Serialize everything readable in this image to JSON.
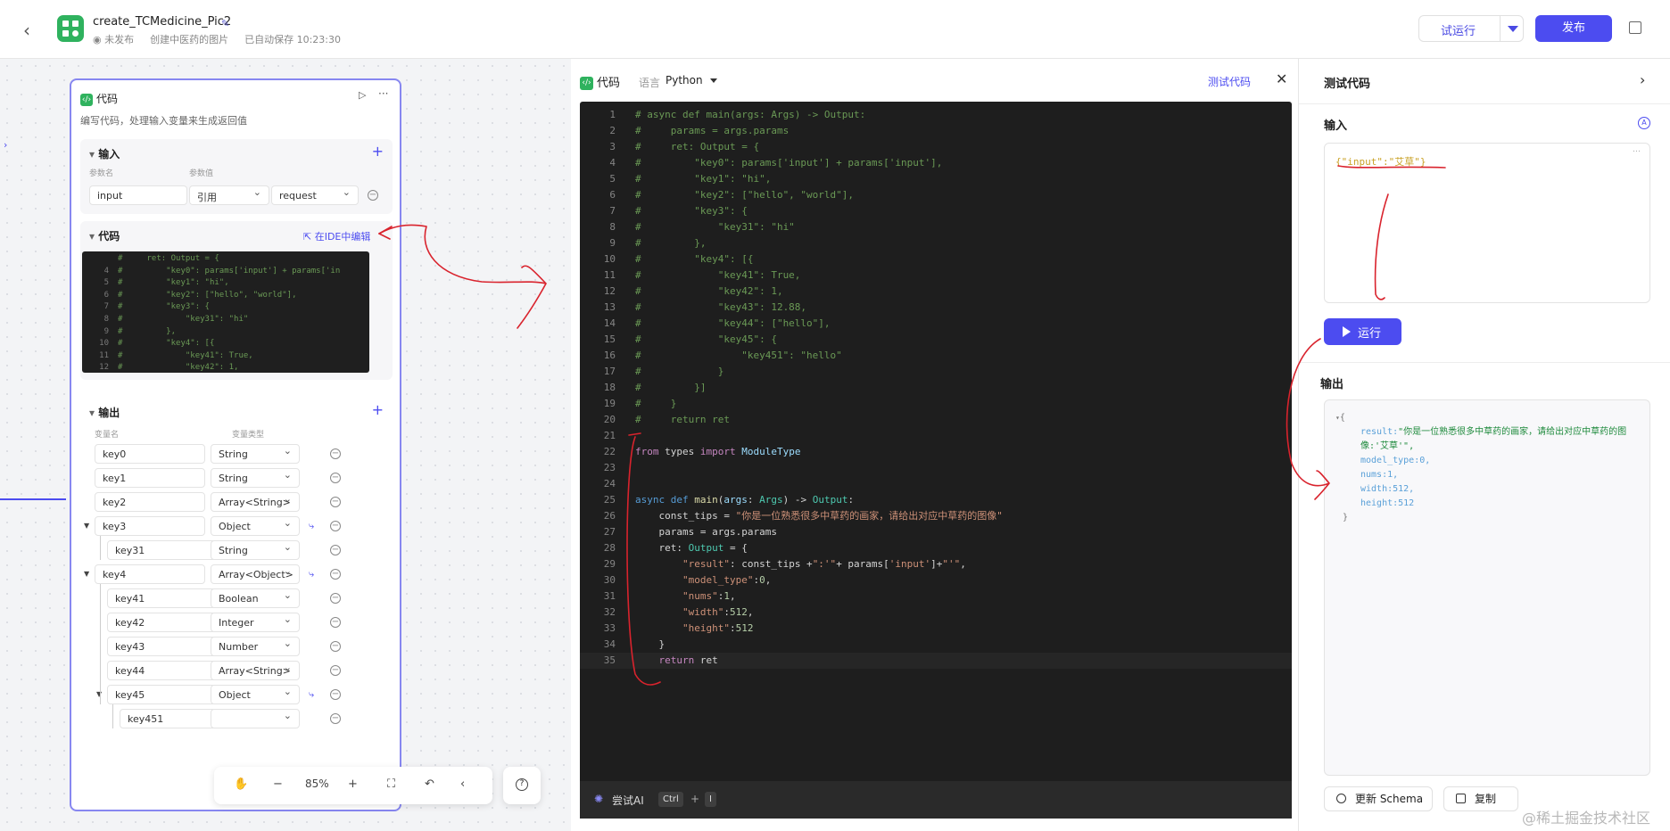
{
  "header": {
    "title": "create_TCMedicine_Pic2",
    "status": "未发布",
    "description": "创建中医药的图片",
    "autosave": "已自动保存 10:23:30",
    "try_run_label": "试运行",
    "publish_label": "发布"
  },
  "node": {
    "title": "代码",
    "description": "编写代码，处理输入变量来生成返回值",
    "input": {
      "title": "输入",
      "param_name_label": "参数名",
      "param_value_label": "参数值",
      "name": "input",
      "source": "引用",
      "value": "request"
    },
    "code": {
      "title": "代码",
      "ide_link": "在IDE中编辑",
      "lines": [
        {
          "n": "",
          "text": "#     ret: Output = {"
        },
        {
          "n": "4",
          "text": "#         \"key0\": params['input'] + params['in"
        },
        {
          "n": "5",
          "text": "#         \"key1\": \"hi\","
        },
        {
          "n": "6",
          "text": "#         \"key2\": [\"hello\", \"world\"],"
        },
        {
          "n": "7",
          "text": "#         \"key3\": {"
        },
        {
          "n": "8",
          "text": "#             \"key31\": \"hi\""
        },
        {
          "n": "9",
          "text": "#         },"
        },
        {
          "n": "10",
          "text": "#         \"key4\": [{"
        },
        {
          "n": "11",
          "text": "#             \"key41\": True,"
        },
        {
          "n": "12",
          "text": "#             \"key42\": 1,"
        }
      ]
    },
    "output": {
      "title": "输出",
      "name_label": "变量名",
      "type_label": "变量类型",
      "rows": [
        {
          "name": "key0",
          "type": "String"
        },
        {
          "name": "key1",
          "type": "String"
        },
        {
          "name": "key2",
          "type": "Array<String>"
        },
        {
          "name": "key3",
          "type": "Object"
        },
        {
          "name": "key31",
          "type": "String"
        },
        {
          "name": "key4",
          "type": "Array<Object>"
        },
        {
          "name": "key41",
          "type": "Boolean"
        },
        {
          "name": "key42",
          "type": "Integer"
        },
        {
          "name": "key43",
          "type": "Number"
        },
        {
          "name": "key44",
          "type": "Array<String>"
        },
        {
          "name": "key45",
          "type": "Object"
        },
        {
          "name": "key451",
          "type": ""
        }
      ]
    }
  },
  "canvas_toolbar": {
    "zoom": "85%"
  },
  "editor": {
    "title": "代码",
    "language_label": "语言",
    "language": "Python",
    "test_code_label": "测试代码",
    "ai_label": "尝试AI",
    "ai_shortcut_key1": "Ctrl",
    "ai_shortcut_plus": "+",
    "ai_shortcut_key2": "I"
  },
  "test_panel": {
    "title": "测试代码",
    "input_label": "输入",
    "input_value": "{\"input\":\"艾草\"}",
    "run_label": "运行",
    "output_label": "输出",
    "output": {
      "result_key": "result:",
      "result_value": "\"你是一位熟悉很多中草药的画家，请给出对应中草药的图像:'艾草'\",",
      "model_type": "model_type:0,",
      "nums": "nums:1,",
      "width": "width:512,",
      "height": "height:512"
    },
    "update_schema_label": "更新 Schema",
    "copy_label": "复制"
  },
  "watermark": "@稀土掘金技术社区",
  "colors": {
    "accent": "#4c4cf0",
    "node_green": "#2fb25e",
    "annotation_red": "#d9232d",
    "editor_bg": "#1e1e1e"
  }
}
